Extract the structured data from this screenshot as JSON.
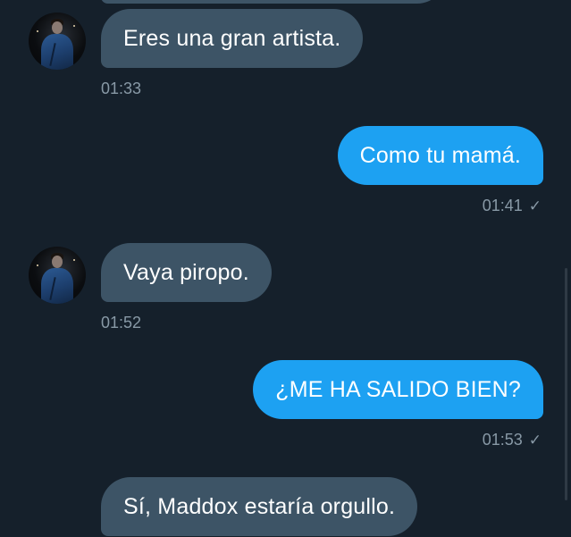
{
  "conversation": {
    "messages": [
      {
        "text": "Eres una gran artista.",
        "time": "01:33",
        "direction": "incoming"
      },
      {
        "text": "Como tu mamá.",
        "time": "01:41",
        "direction": "outgoing",
        "status_icon": "checkmark-icon"
      },
      {
        "text": "Vaya piropo.",
        "time": "01:52",
        "direction": "incoming"
      },
      {
        "text": "¿ME HA SALIDO BIEN?",
        "time": "01:53",
        "direction": "outgoing",
        "status_icon": "checkmark-icon"
      },
      {
        "text": "Sí, Maddox estaría orgullo.",
        "direction": "incoming"
      }
    ],
    "sent_indicator": "✓"
  },
  "colors": {
    "background": "#15202b",
    "incoming_bubble": "#3d5466",
    "outgoing_bubble": "#1da1f2",
    "timestamp": "#8899a6"
  }
}
